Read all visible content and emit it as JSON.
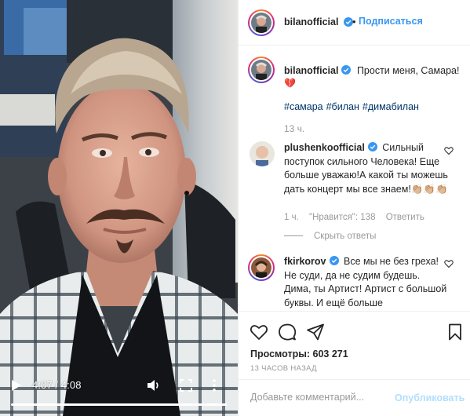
{
  "video": {
    "time": "4:07 / 4:08",
    "progress": 0.996
  },
  "header": {
    "username": "bilanofficial",
    "dot": "•",
    "follow_label": "Подписаться"
  },
  "post": {
    "username": "bilanofficial",
    "caption": "Прости меня, Самара!",
    "emoji": "💔",
    "hashtags": [
      "#самара",
      "#билан",
      "#димабилан"
    ],
    "time": "13 ч."
  },
  "comments": [
    {
      "username": "plushenkoofficial",
      "text": "Сильный поступок сильного Человека! Еще больше уважаю!А какой ты можешь дать концерт мы все знаем!👏🏼👏🏼👏🏼",
      "time": "1 ч.",
      "likes": "\"Нравится\": 138",
      "reply_label": "Ответить",
      "hide_replies": "Скрыть ответы"
    },
    {
      "username": "fkirkorov",
      "text": "Все мы не без греха! Не суди, да не судим будешь. Дима, ты Артист! Артист с большой буквы. И ещё больше"
    }
  ],
  "actions": {
    "views_label": "Просмотры:",
    "views_count": "603 271",
    "ago": "13 ЧАСОВ НАЗАД"
  },
  "add_comment": {
    "placeholder": "Добавьте комментарий...",
    "publish_label": "Опубликовать"
  },
  "colors": {
    "link": "#3897f0",
    "hashtag": "#003569",
    "muted": "#999999",
    "publish_disabled": "#b2dffc",
    "heart": "#ed4956"
  }
}
